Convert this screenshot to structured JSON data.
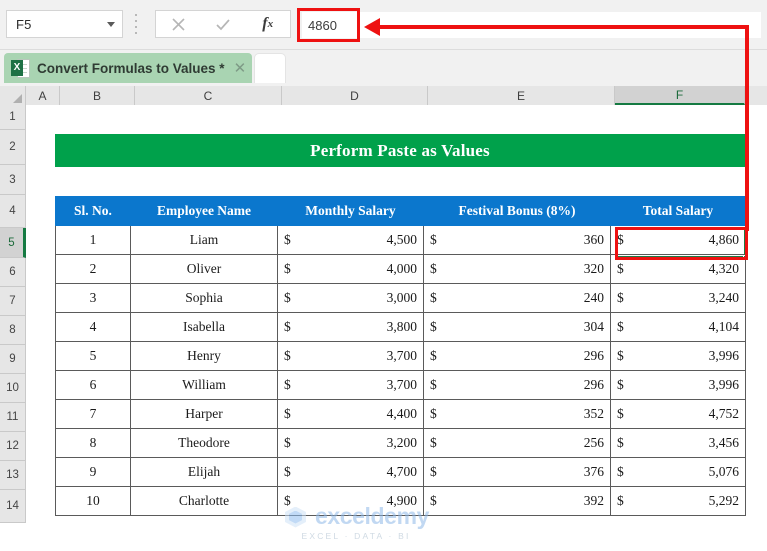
{
  "formula_bar": {
    "name_box_value": "F5",
    "cancel_icon": "close-icon",
    "confirm_icon": "check-icon",
    "function_icon": "fx-icon",
    "fx_label": "f",
    "fx_sub": "x",
    "formula_value": "4860"
  },
  "tab_bar": {
    "workbook_tab_label": "Convert Formulas to Values *",
    "close_glyph": "✕",
    "excel_badge": "X"
  },
  "columns": [
    {
      "label": "A",
      "active": false
    },
    {
      "label": "B",
      "active": false
    },
    {
      "label": "C",
      "active": false
    },
    {
      "label": "D",
      "active": false
    },
    {
      "label": "E",
      "active": false
    },
    {
      "label": "F",
      "active": true
    }
  ],
  "rows": [
    {
      "label": "1",
      "active": false
    },
    {
      "label": "2",
      "active": false
    },
    {
      "label": "3",
      "active": false
    },
    {
      "label": "4",
      "active": false
    },
    {
      "label": "5",
      "active": true
    },
    {
      "label": "6",
      "active": false
    },
    {
      "label": "7",
      "active": false
    },
    {
      "label": "8",
      "active": false
    },
    {
      "label": "9",
      "active": false
    },
    {
      "label": "10",
      "active": false
    },
    {
      "label": "11",
      "active": false
    },
    {
      "label": "12",
      "active": false
    },
    {
      "label": "13",
      "active": false
    },
    {
      "label": "14",
      "active": false
    }
  ],
  "sheet": {
    "banner_title": "Perform Paste as Values",
    "banner_color": "#00a14b",
    "header_color": "#0b77cd",
    "selection_color": "#1f7a46",
    "annotation_color": "#ee1111",
    "currency_symbol": "$",
    "table_headers": [
      "Sl. No.",
      "Employee Name",
      "Monthly Salary",
      "Festival Bonus (8%)",
      "Total Salary"
    ],
    "table_rows": [
      {
        "sl": "1",
        "name": "Liam",
        "salary": "4,500",
        "bonus": "360",
        "total": "4,860"
      },
      {
        "sl": "2",
        "name": "Oliver",
        "salary": "4,000",
        "bonus": "320",
        "total": "4,320"
      },
      {
        "sl": "3",
        "name": "Sophia",
        "salary": "3,000",
        "bonus": "240",
        "total": "3,240"
      },
      {
        "sl": "4",
        "name": "Isabella",
        "salary": "3,800",
        "bonus": "304",
        "total": "4,104"
      },
      {
        "sl": "5",
        "name": "Henry",
        "salary": "3,700",
        "bonus": "296",
        "total": "3,996"
      },
      {
        "sl": "6",
        "name": "William",
        "salary": "3,700",
        "bonus": "296",
        "total": "3,996"
      },
      {
        "sl": "7",
        "name": "Harper",
        "salary": "4,400",
        "bonus": "352",
        "total": "4,752"
      },
      {
        "sl": "8",
        "name": "Theodore",
        "salary": "3,200",
        "bonus": "256",
        "total": "3,456"
      },
      {
        "sl": "9",
        "name": "Elijah",
        "salary": "4,700",
        "bonus": "376",
        "total": "5,076"
      },
      {
        "sl": "10",
        "name": "Charlotte",
        "salary": "4,900",
        "bonus": "392",
        "total": "5,292"
      }
    ]
  },
  "watermark": {
    "word": "exceldemy",
    "subtitle": "EXCEL · DATA · BI"
  }
}
